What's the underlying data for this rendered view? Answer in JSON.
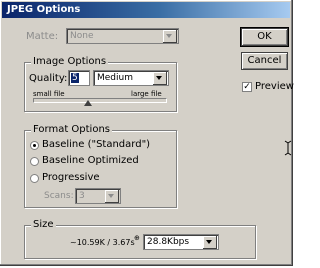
{
  "window": {
    "title": "JPEG Options"
  },
  "matte": {
    "label": "Matte:",
    "value": "None"
  },
  "image_options": {
    "legend": "Image Options",
    "quality_label": "Quality:",
    "quality_value": "5",
    "quality_preset": "Medium",
    "slider_min_label": "small file",
    "slider_max_label": "large file",
    "slider_level": 0.42
  },
  "format_options": {
    "legend": "Format Options",
    "options": [
      "Baseline (\"Standard\")",
      "Baseline Optimized",
      "Progressive"
    ],
    "selected_index": 0,
    "scans_label": "Scans:",
    "scans_value": "3"
  },
  "size": {
    "legend": "Size",
    "estimate": "~10.59K / 3.67s",
    "connection": "28.8Kbps"
  },
  "buttons": {
    "ok": "OK",
    "cancel": "Cancel"
  },
  "preview": {
    "label": "Preview",
    "checked": true
  }
}
